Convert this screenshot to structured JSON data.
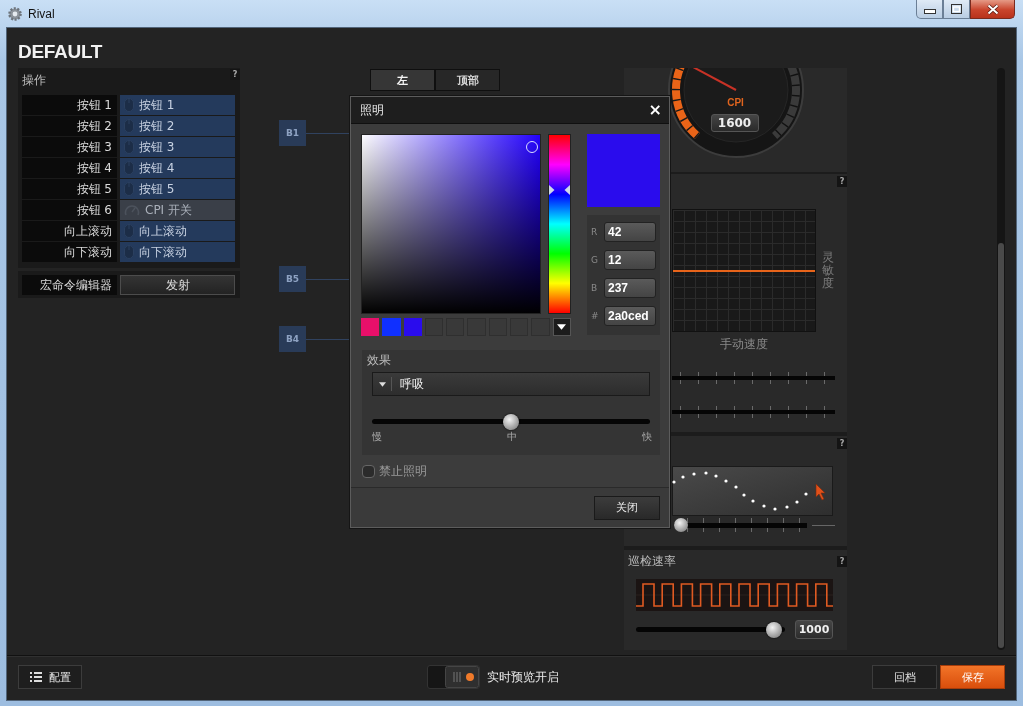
{
  "window": {
    "title": "Rival"
  },
  "profile": {
    "name": "DEFAULT"
  },
  "actions": {
    "title": "操作",
    "help": "?",
    "rows": [
      {
        "button": "按钮 1",
        "action": "按钮 1",
        "kind": "mouse"
      },
      {
        "button": "按钮 2",
        "action": "按钮 2",
        "kind": "mouse"
      },
      {
        "button": "按钮 3",
        "action": "按钮 3",
        "kind": "mouse"
      },
      {
        "button": "按钮 4",
        "action": "按钮 4",
        "kind": "mouse"
      },
      {
        "button": "按钮 5",
        "action": "按钮 5",
        "kind": "mouse"
      },
      {
        "button": "按钮 6",
        "action": "CPI 开关",
        "kind": "cpi"
      },
      {
        "button": "向上滚动",
        "action": "向上滚动",
        "kind": "mouse"
      },
      {
        "button": "向下滚动",
        "action": "向下滚动",
        "kind": "mouse"
      }
    ],
    "macro": {
      "label": "宏命令编辑器",
      "button": "发射"
    }
  },
  "view_tabs": [
    {
      "label": "左",
      "selected": true
    },
    {
      "label": "顶部",
      "selected": false
    }
  ],
  "button_tags": [
    {
      "label": "B1"
    },
    {
      "label": "B5"
    },
    {
      "label": "B4"
    }
  ],
  "cpi": {
    "label": "CPI",
    "value": "1600"
  },
  "sensitivity_panel": {
    "help": "?",
    "y_label": "灵敏度",
    "x_label": "手动速度"
  },
  "curve_panel": {
    "help": "?",
    "slider": {
      "level": 0
    }
  },
  "polling_rate": {
    "title": "巡检速率",
    "help": "?",
    "level": 0.98,
    "value": "1000"
  },
  "lighting_dialog": {
    "title": "照明",
    "close": "×",
    "picker": {
      "color": "#2a0ced"
    },
    "channels": [
      {
        "label": "R",
        "value": "42"
      },
      {
        "label": "G",
        "value": "12"
      },
      {
        "label": "B",
        "value": "237"
      },
      {
        "label": "#",
        "value": "2a0ced"
      }
    ],
    "swatches": [
      {
        "kind": "color",
        "color": "#e8106a"
      },
      {
        "kind": "color",
        "color": "#1030ff"
      },
      {
        "kind": "color",
        "color": "#2a0ced"
      },
      {
        "kind": "empty"
      },
      {
        "kind": "empty"
      },
      {
        "kind": "empty"
      },
      {
        "kind": "empty"
      },
      {
        "kind": "empty"
      },
      {
        "kind": "empty"
      }
    ],
    "effect": {
      "title": "效果",
      "value": "呼吸",
      "speed": {
        "level": 0.5,
        "labels": [
          "慢",
          "中",
          "快"
        ]
      }
    },
    "disable_lighting": {
      "label": "禁止照明",
      "checked": false
    },
    "close_button": "关闭"
  },
  "bottom_bar": {
    "config_button": "配置",
    "live_preview": {
      "label": "实时预览开启",
      "on": true
    },
    "revert_button": "回档",
    "save_button": "保存"
  }
}
